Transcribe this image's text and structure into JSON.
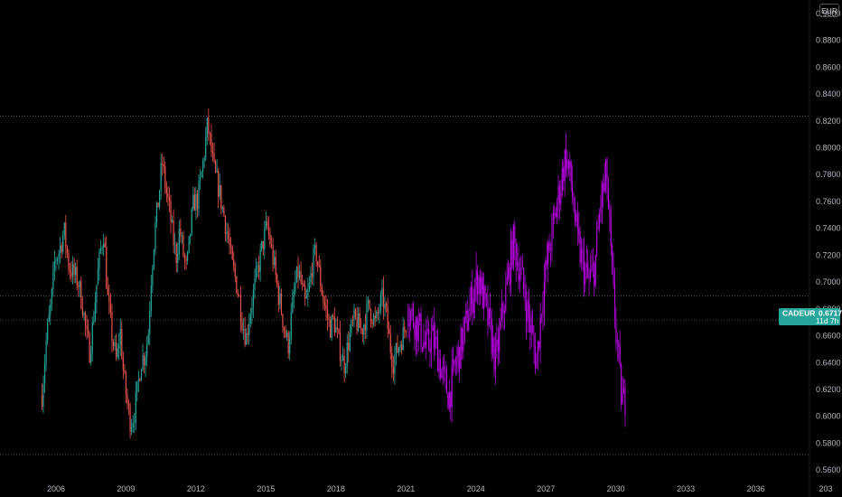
{
  "currency": "EUR",
  "symbol": "CADEUR",
  "price_label": "0.6717",
  "countdown": "11d 7h",
  "colors": {
    "background": "#000000",
    "up": "#26a69a",
    "down": "#ef5350",
    "projection": "#b000d8",
    "grid_dotted": "#5d606b",
    "badge": "#26a69a"
  },
  "chart_data": {
    "type": "candlestick",
    "y_axis": {
      "ticks": [
        "0.9000",
        "0.8800",
        "0.8600",
        "0.8400",
        "0.8200",
        "0.8000",
        "0.7800",
        "0.7600",
        "0.7400",
        "0.7200",
        "0.7000",
        "0.6800",
        "0.6600",
        "0.6400",
        "0.6200",
        "0.6000",
        "0.5800",
        "0.5600"
      ],
      "ylim": [
        0.55,
        0.91
      ]
    },
    "x_axis": {
      "ticks": [
        "2006",
        "2009",
        "2012",
        "2015",
        "2018",
        "2021",
        "2024",
        "2027",
        "2030",
        "2033",
        "2036",
        "203"
      ],
      "xlim": [
        2003.6,
        2038.3
      ]
    },
    "horizontal_lines": [
      0.8235,
      0.6895,
      0.6717,
      0.5715
    ],
    "current_price": 0.6717,
    "series": [
      {
        "kind": "historical",
        "points": [
          [
            2005.4,
            0.616
          ],
          [
            2005.6,
            0.66
          ],
          [
            2005.8,
            0.685
          ],
          [
            2005.95,
            0.716
          ],
          [
            2006.15,
            0.724
          ],
          [
            2006.35,
            0.738
          ],
          [
            2006.55,
            0.712
          ],
          [
            2006.75,
            0.706
          ],
          [
            2006.95,
            0.7
          ],
          [
            2007.15,
            0.682
          ],
          [
            2007.3,
            0.66
          ],
          [
            2007.45,
            0.648
          ],
          [
            2007.6,
            0.672
          ],
          [
            2007.75,
            0.7
          ],
          [
            2007.9,
            0.722
          ],
          [
            2008.05,
            0.738
          ],
          [
            2008.2,
            0.69
          ],
          [
            2008.4,
            0.66
          ],
          [
            2008.6,
            0.64
          ],
          [
            2008.75,
            0.665
          ],
          [
            2008.9,
            0.63
          ],
          [
            2009.05,
            0.61
          ],
          [
            2009.2,
            0.595
          ],
          [
            2009.35,
            0.602
          ],
          [
            2009.5,
            0.62
          ],
          [
            2009.65,
            0.642
          ],
          [
            2009.8,
            0.645
          ],
          [
            2009.95,
            0.66
          ],
          [
            2010.1,
            0.71
          ],
          [
            2010.25,
            0.74
          ],
          [
            2010.4,
            0.762
          ],
          [
            2010.55,
            0.79
          ],
          [
            2010.7,
            0.77
          ],
          [
            2010.85,
            0.755
          ],
          [
            2011.0,
            0.735
          ],
          [
            2011.15,
            0.718
          ],
          [
            2011.3,
            0.74
          ],
          [
            2011.45,
            0.722
          ],
          [
            2011.6,
            0.708
          ],
          [
            2011.75,
            0.736
          ],
          [
            2011.9,
            0.76
          ],
          [
            2012.05,
            0.76
          ],
          [
            2012.2,
            0.775
          ],
          [
            2012.35,
            0.795
          ],
          [
            2012.5,
            0.818
          ],
          [
            2012.65,
            0.798
          ],
          [
            2012.8,
            0.78
          ],
          [
            2012.95,
            0.772
          ],
          [
            2013.1,
            0.758
          ],
          [
            2013.25,
            0.745
          ],
          [
            2013.4,
            0.73
          ],
          [
            2013.55,
            0.712
          ],
          [
            2013.7,
            0.702
          ],
          [
            2013.85,
            0.688
          ],
          [
            2014.0,
            0.67
          ],
          [
            2014.15,
            0.658
          ],
          [
            2014.3,
            0.676
          ],
          [
            2014.45,
            0.69
          ],
          [
            2014.6,
            0.705
          ],
          [
            2014.75,
            0.718
          ],
          [
            2014.9,
            0.732
          ],
          [
            2015.05,
            0.742
          ],
          [
            2015.2,
            0.728
          ],
          [
            2015.35,
            0.712
          ],
          [
            2015.5,
            0.694
          ],
          [
            2015.65,
            0.68
          ],
          [
            2015.8,
            0.664
          ],
          [
            2015.95,
            0.652
          ],
          [
            2016.1,
            0.676
          ],
          [
            2016.25,
            0.698
          ],
          [
            2016.4,
            0.708
          ],
          [
            2016.55,
            0.694
          ],
          [
            2016.7,
            0.682
          ],
          [
            2016.85,
            0.695
          ],
          [
            2017.0,
            0.715
          ],
          [
            2017.15,
            0.722
          ],
          [
            2017.3,
            0.704
          ],
          [
            2017.45,
            0.688
          ],
          [
            2017.6,
            0.676
          ],
          [
            2017.75,
            0.666
          ],
          [
            2017.9,
            0.672
          ],
          [
            2018.05,
            0.66
          ],
          [
            2018.2,
            0.648
          ],
          [
            2018.35,
            0.638
          ],
          [
            2018.5,
            0.652
          ],
          [
            2018.65,
            0.664
          ],
          [
            2018.8,
            0.672
          ],
          [
            2018.95,
            0.668
          ],
          [
            2019.1,
            0.664
          ],
          [
            2019.25,
            0.672
          ],
          [
            2019.4,
            0.682
          ],
          [
            2019.55,
            0.676
          ],
          [
            2019.7,
            0.668
          ],
          [
            2019.85,
            0.68
          ],
          [
            2020.0,
            0.688
          ],
          [
            2020.15,
            0.676
          ],
          [
            2020.3,
            0.655
          ],
          [
            2020.45,
            0.64
          ],
          [
            2020.6,
            0.648
          ],
          [
            2020.75,
            0.655
          ],
          [
            2020.9,
            0.662
          ],
          [
            2021.05,
            0.672
          ]
        ]
      },
      {
        "kind": "projection",
        "points": [
          [
            2021.1,
            0.68
          ],
          [
            2021.35,
            0.672
          ],
          [
            2021.6,
            0.664
          ],
          [
            2021.85,
            0.65
          ],
          [
            2022.1,
            0.66
          ],
          [
            2022.35,
            0.648
          ],
          [
            2022.6,
            0.628
          ],
          [
            2022.85,
            0.615
          ],
          [
            2023.1,
            0.636
          ],
          [
            2023.35,
            0.652
          ],
          [
            2023.6,
            0.67
          ],
          [
            2023.85,
            0.69
          ],
          [
            2024.1,
            0.705
          ],
          [
            2024.35,
            0.685
          ],
          [
            2024.6,
            0.665
          ],
          [
            2024.85,
            0.64
          ],
          [
            2025.1,
            0.672
          ],
          [
            2025.35,
            0.7
          ],
          [
            2025.6,
            0.73
          ],
          [
            2025.85,
            0.712
          ],
          [
            2026.1,
            0.69
          ],
          [
            2026.35,
            0.665
          ],
          [
            2026.6,
            0.64
          ],
          [
            2026.85,
            0.69
          ],
          [
            2027.1,
            0.72
          ],
          [
            2027.35,
            0.745
          ],
          [
            2027.6,
            0.77
          ],
          [
            2027.85,
            0.795
          ],
          [
            2028.1,
            0.772
          ],
          [
            2028.35,
            0.73
          ],
          [
            2028.6,
            0.712
          ],
          [
            2028.85,
            0.7
          ],
          [
            2029.1,
            0.712
          ],
          [
            2029.35,
            0.76
          ],
          [
            2029.6,
            0.78
          ],
          [
            2029.85,
            0.7
          ],
          [
            2030.05,
            0.655
          ],
          [
            2030.2,
            0.62
          ],
          [
            2030.3,
            0.61
          ],
          [
            2030.45,
            0.615
          ]
        ]
      }
    ]
  }
}
